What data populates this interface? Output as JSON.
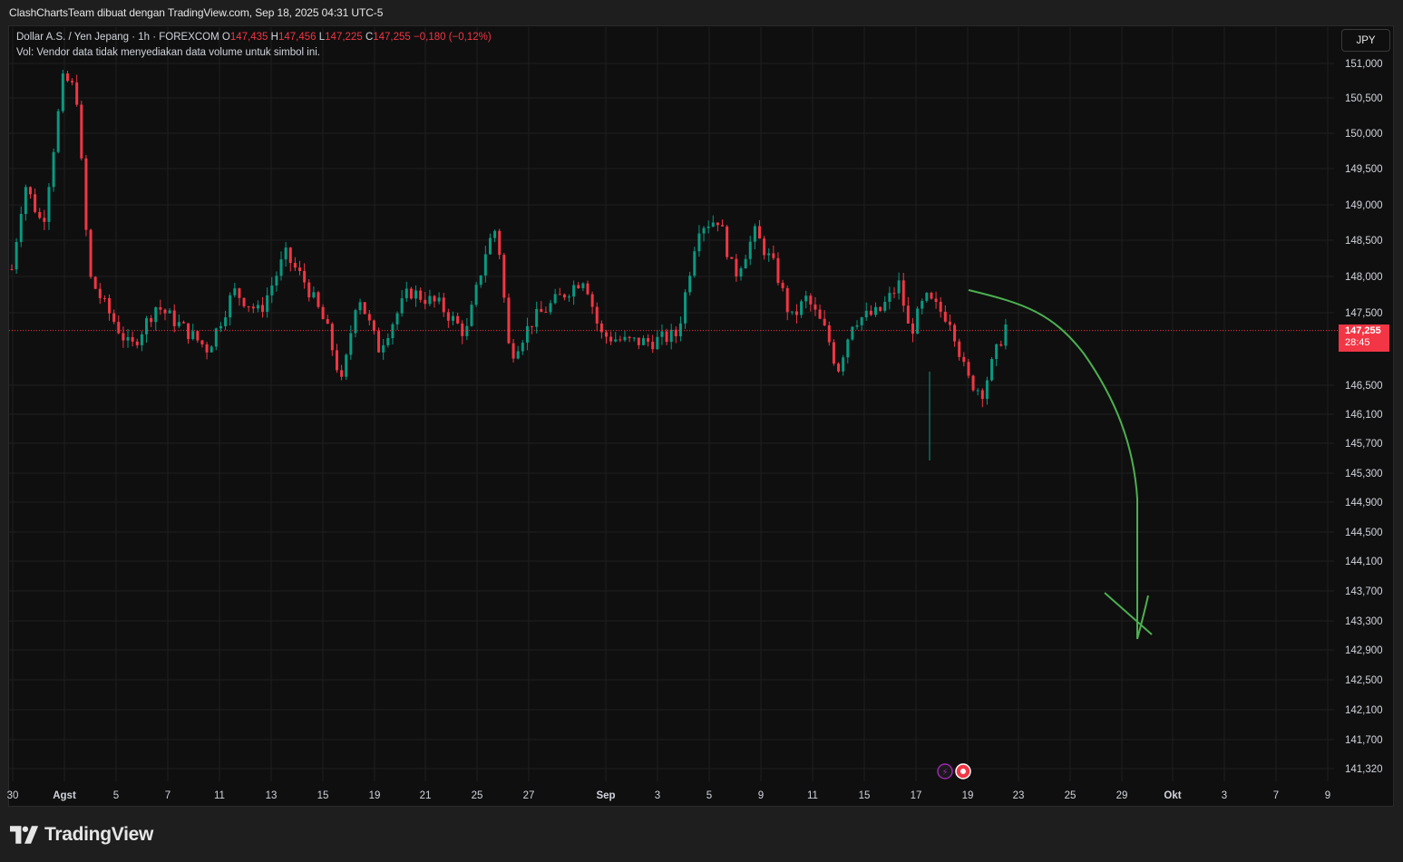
{
  "header": {
    "attribution": "ClashChartsTeam dibuat dengan TradingView.com, Sep 18, 2025 04:31 UTC-5"
  },
  "legend": {
    "symbol": "Dollar A.S. / Yen Jepang · 1h · FOREXCOM",
    "open_label": "O",
    "open": "147,435",
    "high_label": "H",
    "high": "147,456",
    "low_label": "L",
    "low": "147,225",
    "close_label": "C",
    "close": "147,255",
    "change": "−0,180 (−0,12%)",
    "volume_note": "Vol: Vendor data tidak menyediakan data volume untuk simbol ini."
  },
  "currency_button": "JPY",
  "last_price": {
    "value": "147,255",
    "countdown": "28:45"
  },
  "footer": {
    "brand": "TradingView"
  },
  "colors": {
    "up": "#089981",
    "down": "#f23645",
    "drawing": "#4caf50",
    "grid": "#1f1f1f"
  },
  "chart_data": {
    "type": "candlestick",
    "title": "",
    "interval": "1h",
    "grid": true,
    "last_price_line": 147.255,
    "y_ticks": [
      "151,000",
      "150,500",
      "150,000",
      "149,500",
      "149,000",
      "148,500",
      "148,000",
      "147,500",
      "146,500",
      "146,100",
      "145,700",
      "145,300",
      "144,900",
      "144,500",
      "144,100",
      "143,700",
      "143,300",
      "142,900",
      "142,500",
      "142,100",
      "141,700",
      "141,320"
    ],
    "x_ticks": [
      "30",
      "Agst",
      "5",
      "7",
      "11",
      "13",
      "15",
      "19",
      "21",
      "25",
      "27",
      "Sep",
      "3",
      "5",
      "9",
      "11",
      "15",
      "17",
      "19",
      "23",
      "25",
      "29",
      "Okt",
      "3",
      "7",
      "9"
    ],
    "x_bold_ticks": [
      "Agst",
      "Sep",
      "Okt"
    ],
    "keypoints": [
      {
        "x": 0,
        "y": 148.1
      },
      {
        "x": 0.5,
        "y": 149.3
      },
      {
        "x": 1.2,
        "y": 148.7
      },
      {
        "x": 2.0,
        "y": 150.8
      },
      {
        "x": 2.5,
        "y": 150.6
      },
      {
        "x": 3.0,
        "y": 148.0
      },
      {
        "x": 3.6,
        "y": 147.6
      },
      {
        "x": 4.6,
        "y": 147.0
      },
      {
        "x": 5.6,
        "y": 147.6
      },
      {
        "x": 6.6,
        "y": 147.3
      },
      {
        "x": 7.6,
        "y": 147.0
      },
      {
        "x": 8.6,
        "y": 147.8
      },
      {
        "x": 9.6,
        "y": 147.5
      },
      {
        "x": 10.6,
        "y": 148.3
      },
      {
        "x": 11.4,
        "y": 147.9
      },
      {
        "x": 12.2,
        "y": 147.3
      },
      {
        "x": 12.8,
        "y": 146.5
      },
      {
        "x": 13.4,
        "y": 147.8
      },
      {
        "x": 14.2,
        "y": 147.0
      },
      {
        "x": 15.4,
        "y": 147.8
      },
      {
        "x": 16.6,
        "y": 147.6
      },
      {
        "x": 17.6,
        "y": 147.2
      },
      {
        "x": 18.4,
        "y": 148.4
      },
      {
        "x": 18.8,
        "y": 148.7
      },
      {
        "x": 19.3,
        "y": 146.9
      },
      {
        "x": 20.2,
        "y": 147.4
      },
      {
        "x": 21.2,
        "y": 147.7
      },
      {
        "x": 22.2,
        "y": 148.0
      },
      {
        "x": 22.8,
        "y": 147.2
      },
      {
        "x": 23.8,
        "y": 147.1
      },
      {
        "x": 24.8,
        "y": 147.1
      },
      {
        "x": 25.8,
        "y": 147.2
      },
      {
        "x": 26.6,
        "y": 148.7
      },
      {
        "x": 27.4,
        "y": 148.8
      },
      {
        "x": 28.0,
        "y": 148.0
      },
      {
        "x": 28.8,
        "y": 148.6
      },
      {
        "x": 29.6,
        "y": 148.1
      },
      {
        "x": 30.2,
        "y": 147.4
      },
      {
        "x": 30.8,
        "y": 147.7
      },
      {
        "x": 31.6,
        "y": 147.2
      },
      {
        "x": 32.0,
        "y": 146.7
      },
      {
        "x": 32.6,
        "y": 147.4
      },
      {
        "x": 33.6,
        "y": 147.5
      },
      {
        "x": 34.4,
        "y": 147.9
      },
      {
        "x": 34.8,
        "y": 147.2
      },
      {
        "x": 35.4,
        "y": 147.7
      },
      {
        "x": 36.4,
        "y": 147.4
      },
      {
        "x": 37.0,
        "y": 146.6
      },
      {
        "x": 37.6,
        "y": 146.4
      },
      {
        "x": 38.2,
        "y": 147.0
      },
      {
        "x": 38.6,
        "y": 147.4
      }
    ],
    "ylim": [
      141.1,
      151.4
    ],
    "xlim": [
      0,
      58
    ],
    "annotation": "hand-drawn curved arrow pointing down toward ~143,1"
  }
}
